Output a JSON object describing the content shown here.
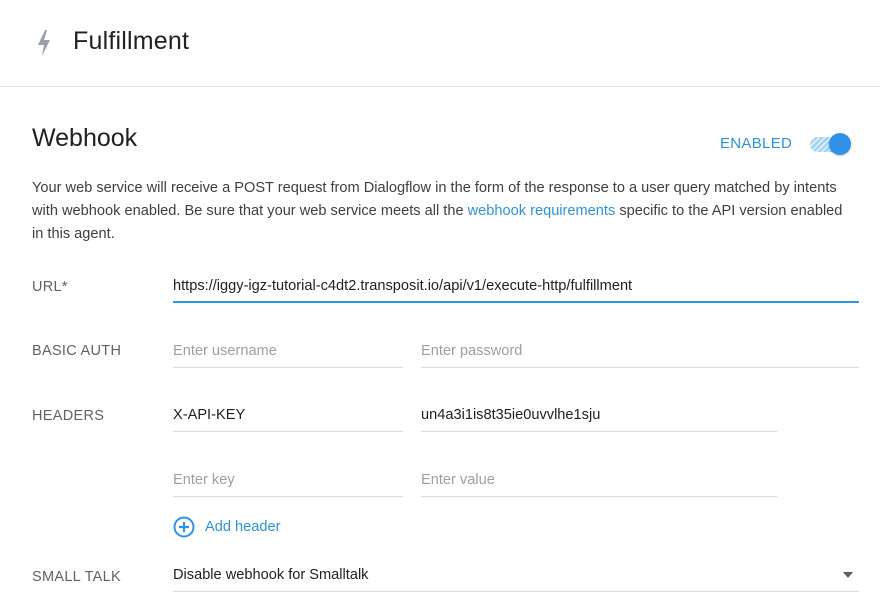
{
  "header": {
    "title": "Fulfillment",
    "icon": "bolt-icon"
  },
  "webhook": {
    "title": "Webhook",
    "status_label": "ENABLED",
    "enabled": true,
    "description_before": "Your web service will receive a POST request from Dialogflow in the form of the response to a user query matched by intents with webhook enabled. Be sure that your web service meets all the ",
    "description_link": "webhook requirements",
    "description_after": " specific to the API version enabled in this agent."
  },
  "url": {
    "label": "URL*",
    "value": "https://iggy-igz-tutorial-c4dt2.transposit.io/api/v1/execute-http/fulfillment"
  },
  "basic_auth": {
    "label": "BASIC AUTH",
    "username_placeholder": "Enter username",
    "password_placeholder": "Enter password"
  },
  "headers": {
    "label": "HEADERS",
    "rows": [
      {
        "key": "X-API-KEY",
        "value": "un4a3i1is8t35ie0uvvlhe1sju"
      }
    ],
    "key_placeholder": "Enter key",
    "value_placeholder": "Enter value",
    "add_label": "Add header"
  },
  "small_talk": {
    "label": "SMALL TALK",
    "selected": "Disable webhook for Smalltalk"
  },
  "colors": {
    "accent": "#2e93e6",
    "link": "#2e93d6"
  }
}
